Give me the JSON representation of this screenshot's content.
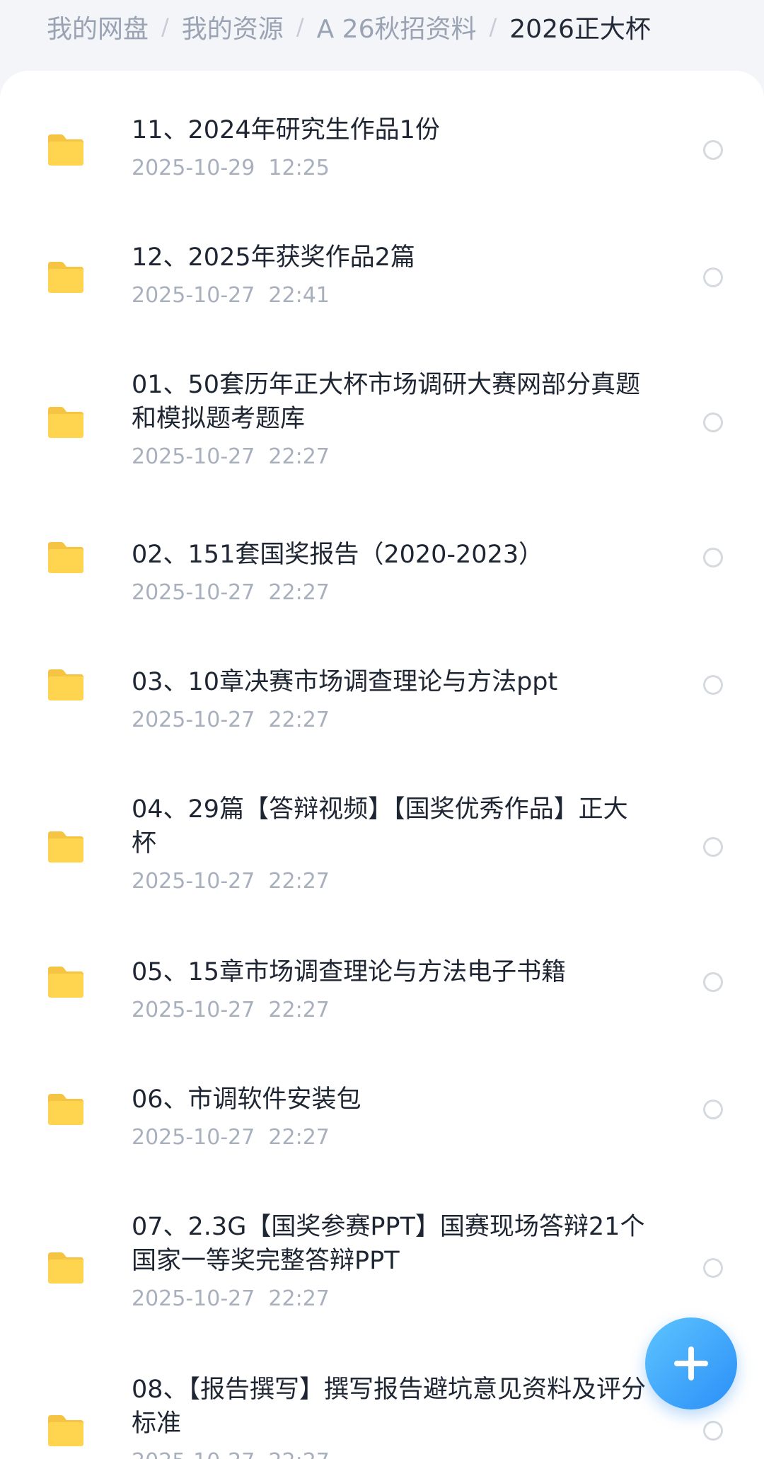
{
  "breadcrumb": {
    "items": [
      "我的网盘",
      "我的资源",
      "A 26秋招资料"
    ],
    "current": "2026正大杯",
    "separator": "/"
  },
  "files": [
    {
      "name": "11、2024年研究生作品1份",
      "date": "2025-10-29  12:25"
    },
    {
      "name": "12、2025年获奖作品2篇",
      "date": "2025-10-27  22:41"
    },
    {
      "name": "01、50套历年正大杯市场调研大赛网部分真题和模拟题考题库",
      "date": "2025-10-27  22:27"
    },
    {
      "name": "02、151套国奖报告（2020-2023）",
      "date": "2025-10-27  22:27"
    },
    {
      "name": "03、10章决赛市场调查理论与方法ppt",
      "date": "2025-10-27  22:27"
    },
    {
      "name": "04、29篇【答辩视频】【国奖优秀作品】正大杯",
      "date": "2025-10-27  22:27"
    },
    {
      "name": "05、15章市场调查理论与方法电子书籍",
      "date": "2025-10-27  22:27"
    },
    {
      "name": "06、市调软件安装包",
      "date": "2025-10-27  22:27"
    },
    {
      "name": "07、2.3G【国奖参赛PPT】国赛现场答辩21个国家一等奖完整答辩PPT",
      "date": "2025-10-27  22:27"
    },
    {
      "name": "08、【报告撰写】撰写报告避坑意见资料及评分标准",
      "date": "2025-10-27  22:27"
    }
  ],
  "icons": {
    "folder": "folder-icon",
    "select": "select-circle-icon",
    "fab": "plus-icon"
  },
  "colors": {
    "folder": "#ffd54f",
    "accent": "#2a8ff7"
  }
}
